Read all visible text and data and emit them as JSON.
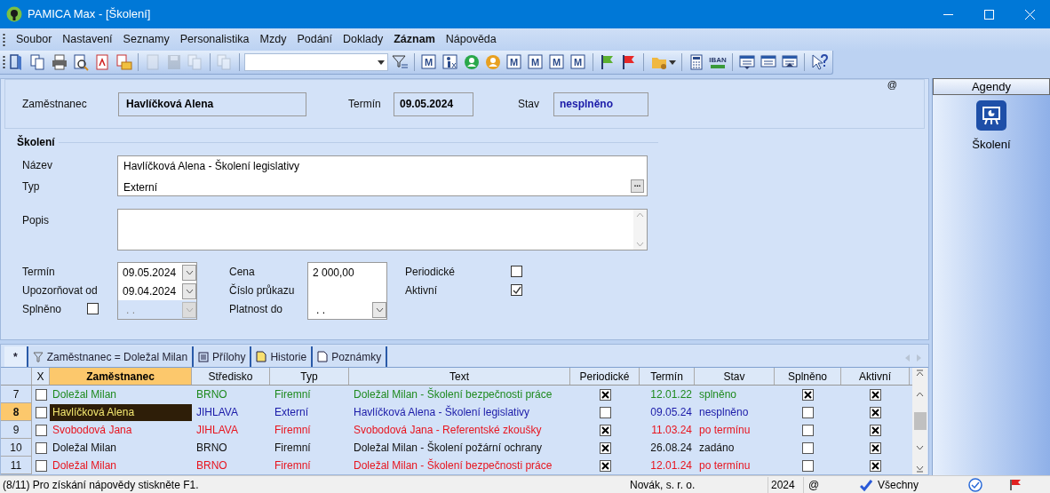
{
  "window": {
    "title": "PAMICA Max - [Školení]"
  },
  "menu": [
    {
      "label": "Soubor",
      "active": false
    },
    {
      "label": "Nastavení",
      "active": false
    },
    {
      "label": "Seznamy",
      "active": false
    },
    {
      "label": "Personalistika",
      "active": false
    },
    {
      "label": "Mzdy",
      "active": false
    },
    {
      "label": "Podání",
      "active": false
    },
    {
      "label": "Doklady",
      "active": false
    },
    {
      "label": "Záznam",
      "active": true
    },
    {
      "label": "Nápověda",
      "active": false
    }
  ],
  "toolbar": [
    {
      "kind": "button",
      "disabled": false
    },
    {
      "kind": "button",
      "disabled": false
    },
    {
      "kind": "button",
      "disabled": false
    },
    {
      "kind": "button",
      "disabled": false
    },
    {
      "kind": "button",
      "disabled": false
    },
    {
      "kind": "button",
      "disabled": false
    },
    {
      "kind": "separator"
    },
    {
      "kind": "button",
      "disabled": true
    },
    {
      "kind": "button",
      "disabled": true
    },
    {
      "kind": "button",
      "disabled": true
    },
    {
      "kind": "separator"
    },
    {
      "kind": "button",
      "disabled": true
    },
    {
      "kind": "separator"
    },
    {
      "kind": "combo"
    },
    {
      "kind": "button",
      "disabled": false
    },
    {
      "kind": "separator"
    },
    {
      "kind": "button",
      "label": "M",
      "disabled": false
    },
    {
      "kind": "button",
      "disabled": false
    },
    {
      "kind": "button",
      "disabled": false
    },
    {
      "kind": "button",
      "disabled": false
    },
    {
      "kind": "button",
      "label": "M",
      "disabled": false
    },
    {
      "kind": "button",
      "label": "M",
      "disabled": false
    },
    {
      "kind": "button",
      "label": "M",
      "disabled": false
    },
    {
      "kind": "button",
      "label": "M",
      "disabled": false
    },
    {
      "kind": "separator"
    },
    {
      "kind": "button",
      "disabled": false
    },
    {
      "kind": "button",
      "disabled": false
    },
    {
      "kind": "separator"
    },
    {
      "kind": "button",
      "disabled": false
    },
    {
      "kind": "separator"
    },
    {
      "kind": "button",
      "disabled": false
    },
    {
      "kind": "button",
      "label": "IBAN",
      "disabled": false
    },
    {
      "kind": "separator"
    },
    {
      "kind": "button",
      "disabled": false
    },
    {
      "kind": "button",
      "disabled": false
    },
    {
      "kind": "button",
      "disabled": false
    },
    {
      "kind": "separator"
    },
    {
      "kind": "button",
      "disabled": false
    }
  ],
  "header": {
    "at_sign": "@",
    "employee": {
      "label": "Zaměstnanec",
      "value": "Havlíčková Alena"
    },
    "date": {
      "label": "Termín",
      "value": "09.05.2024"
    },
    "status": {
      "label": "Stav",
      "value": "nesplněno"
    }
  },
  "training": {
    "title": "Školení",
    "name": {
      "label": "Název",
      "value": "Havlíčková Alena - Školení legislativy"
    },
    "type": {
      "label": "Typ",
      "value": "Externí",
      "button": "..."
    },
    "description": {
      "label": "Popis"
    },
    "date": {
      "label": "Termín",
      "value": "09.05.2024"
    },
    "remind_from": {
      "label": "Upozorňovat od",
      "value": "09.04.2024"
    },
    "completed": {
      "label": "Splněno",
      "checked": false
    },
    "completed_date": {
      "value": ". .",
      "disabled": true
    },
    "price": {
      "label": "Cena",
      "value": "2 000,00"
    },
    "card_number": {
      "label": "Číslo průkazu"
    },
    "valid_until": {
      "label": "Platnost do",
      "value": ". ."
    },
    "periodic": {
      "label": "Periodické",
      "checked": false
    },
    "active": {
      "label": "Aktivní",
      "checked": true
    }
  },
  "grid_tabs": [
    {
      "label": "*",
      "selected": true
    },
    {
      "label": "Zaměstnanec = Doležal Milan",
      "selected": false
    },
    {
      "label": "Přílohy",
      "selected": false
    },
    {
      "label": "Historie",
      "selected": false
    },
    {
      "label": "Poznámky",
      "selected": false
    }
  ],
  "table": {
    "columns": [
      {
        "label": "X",
        "sorted": false
      },
      {
        "label": "Zaměstnanec",
        "sorted": true
      },
      {
        "label": "Středisko",
        "sorted": false
      },
      {
        "label": "Typ",
        "sorted": false
      },
      {
        "label": "Text",
        "sorted": false
      },
      {
        "label": "Periodické",
        "sorted": false
      },
      {
        "label": "Termín",
        "sorted": false
      },
      {
        "label": "Stav",
        "sorted": false
      },
      {
        "label": "Splněno",
        "sorted": false
      },
      {
        "label": "Aktivní",
        "sorted": false
      }
    ],
    "rows": [
      {
        "number": "7",
        "selected": false,
        "color": "#1e8a1e",
        "marked": false,
        "employee": "Doležal Milan",
        "center": "BRNO",
        "type": "Firemní",
        "text": "Doležal Milan - Školení bezpečnosti práce",
        "periodic": true,
        "date": "12.01.22",
        "status": "splněno",
        "completed": true,
        "active": true
      },
      {
        "number": "8",
        "selected": true,
        "color": "#1a1aa8",
        "marked": false,
        "employee": "Havlíčková Alena",
        "center": "JIHLAVA",
        "type": "Externí",
        "text": "Havlíčková Alena - Školení legislativy",
        "periodic": false,
        "date": "09.05.24",
        "status": "nesplněno",
        "completed": false,
        "active": true
      },
      {
        "number": "9",
        "selected": false,
        "color": "#e8141e",
        "marked": false,
        "employee": "Svobodová Jana",
        "center": "JIHLAVA",
        "type": "Firemní",
        "text": "Svobodová Jana - Referentské zkoušky",
        "periodic": true,
        "date": "11.03.24",
        "status": "po termínu",
        "completed": false,
        "active": true
      },
      {
        "number": "10",
        "selected": false,
        "color": "#111111",
        "marked": false,
        "employee": "Doležal Milan",
        "center": "BRNO",
        "type": "Firemní",
        "text": "Doležal Milan - Školení požární ochrany",
        "periodic": true,
        "date": "26.08.24",
        "status": "zadáno",
        "completed": false,
        "active": true
      },
      {
        "number": "11",
        "selected": false,
        "color": "#e8141e",
        "marked": false,
        "employee": "Doležal Milan",
        "center": "BRNO",
        "type": "Firemní",
        "text": "Doležal Milan - Školení bezpečnosti práce",
        "periodic": true,
        "date": "12.01.24",
        "status": "po termínu",
        "completed": false,
        "active": true
      }
    ]
  },
  "agendas": {
    "title": "Agendy",
    "items": [
      {
        "label": "Školení",
        "selected": true
      }
    ]
  },
  "status_bar": {
    "message": "(8/11) Pro získání nápovědy stiskněte F1.",
    "company": "Novák, s. r. o.",
    "year": "2024",
    "at_sign": "@",
    "filter": "Všechny"
  }
}
